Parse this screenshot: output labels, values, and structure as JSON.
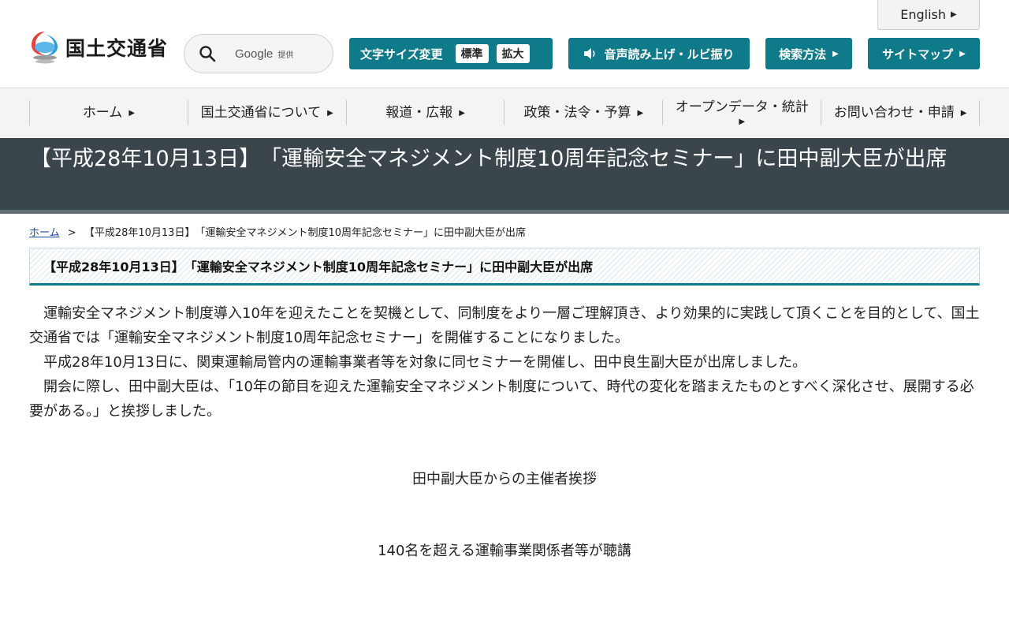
{
  "header": {
    "lang_link": "English",
    "logo_text": "国土交通省",
    "search": {
      "brand": "Google",
      "provider": "提供"
    },
    "font_size": {
      "label": "文字サイズ変更",
      "standard": "標準",
      "large": "拡大"
    },
    "voice_label": "音声読み上げ・ルビ振り",
    "search_help_label": "検索方法",
    "sitemap_label": "サイトマップ"
  },
  "gnav": {
    "items": [
      {
        "label": "ホーム"
      },
      {
        "label": "国土交通省について"
      },
      {
        "label": "報道・広報"
      },
      {
        "label": "政策・法令・予算"
      },
      {
        "label": "オープンデータ・統計"
      },
      {
        "label": "お問い合わせ・申請"
      }
    ]
  },
  "page": {
    "title": "【平成28年10月13日】　「運輸安全マネジメント制度10周年記念セミナー」に田中副大臣が出席",
    "breadcrumb": {
      "home": "ホーム",
      "separator": ">",
      "current": "【平成28年10月13日】　「運輸安全マネジメント制度10周年記念セミナー」に田中副大臣が出席"
    },
    "section_heading": "【平成28年10月13日】　「運輸安全マネジメント制度10周年記念セミナー」に田中副大臣が出席",
    "paragraphs": [
      "運輸安全マネジメント制度導入10年を迎えたことを契機として、同制度をより一層ご理解頂き、より効果的に実践して頂くことを目的として、国土交通省では「運輸安全マネジメント制度10周年記念セミナー」を開催することになりました。",
      "平成28年10月13日に、関東運輸局管内の運輸事業者等を対象に同セミナーを開催し、田中良生副大臣が出席しました。",
      "開会に際し、田中副大臣は、「10年の節目を迎えた運輸安全マネジメント制度について、時代の変化を踏まえたものとすべく深化させ、展開する必要がある。」と挨拶しました。"
    ],
    "captions": [
      "田中副大臣からの主催者挨拶",
      "140名を超える運輸事業関係者等が聴講"
    ]
  },
  "colors": {
    "accent": "#0f7a8a",
    "title_band": "#3b464c",
    "nav_bg": "#f4f4f4"
  }
}
